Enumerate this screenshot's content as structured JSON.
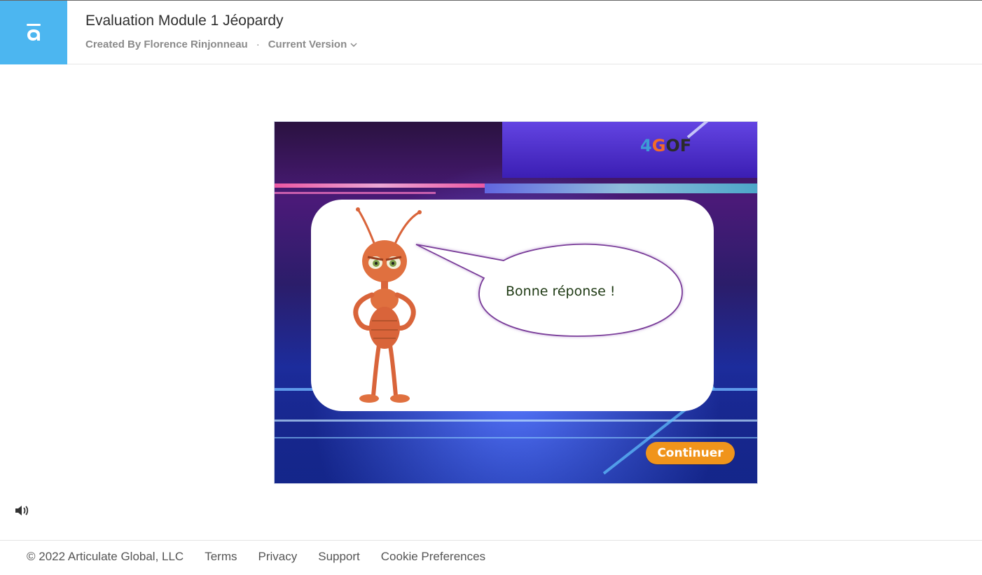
{
  "header": {
    "title": "Evaluation Module 1 Jéopardy",
    "created_by": "Created By Florence Rinjonneau",
    "separator": "·",
    "version": "Current Version",
    "logo_icon": "articulate-a-icon",
    "logo_color": "#4cb6f0"
  },
  "stage": {
    "brand": {
      "part1": "4",
      "part2": "G",
      "part3": "OF"
    },
    "feedback": "Bonne réponse !",
    "continue_label": "Continuer",
    "continue_color": "#f0941b"
  },
  "controls": {
    "sound_icon": "speaker-icon"
  },
  "footer": {
    "copyright": "© 2022 Articulate Global, LLC",
    "links": [
      "Terms",
      "Privacy",
      "Support",
      "Cookie Preferences"
    ]
  }
}
